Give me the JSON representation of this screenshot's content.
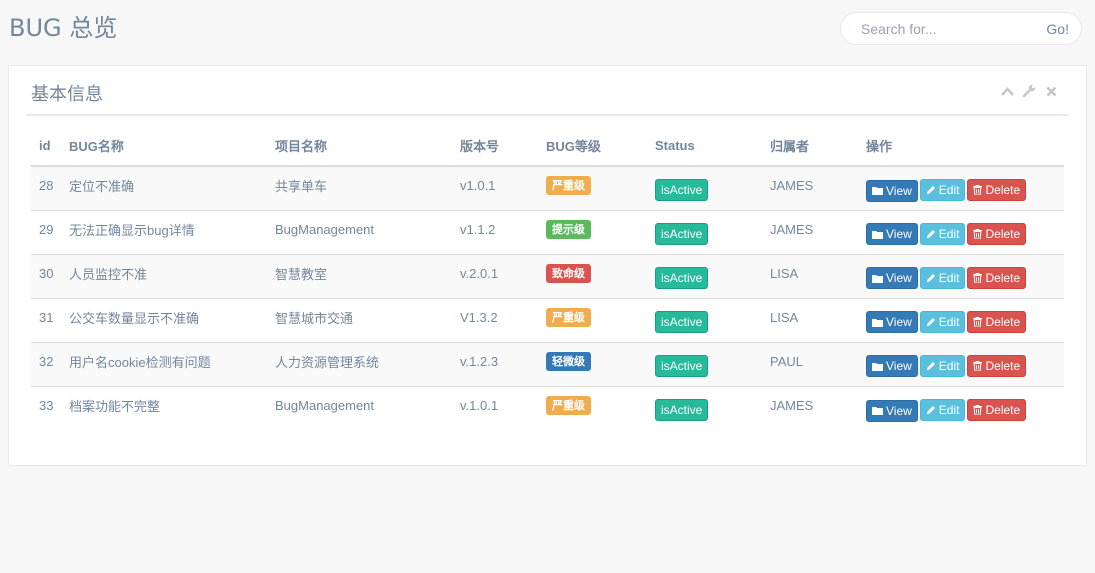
{
  "header": {
    "title": "BUG 总览",
    "search_placeholder": "Search for...",
    "search_button": "Go!"
  },
  "panel": {
    "title": "基本信息",
    "tools": [
      "chevron-up-icon",
      "wrench-icon",
      "close-icon"
    ]
  },
  "table": {
    "columns": {
      "id": "id",
      "name": "BUG名称",
      "project": "项目名称",
      "version": "版本号",
      "level": "BUG等级",
      "status": "Status",
      "owner": "归属者",
      "actions": "操作"
    },
    "rows": [
      {
        "id": "28",
        "name": "定位不准确",
        "project": "共享单车",
        "version": "v1.0.1",
        "level": "严重级",
        "level_color": "#f0ad4e",
        "status": "isActive",
        "owner": "JAMES"
      },
      {
        "id": "29",
        "name": "无法正确显示bug详情",
        "project": "BugManagement",
        "version": "v1.1.2",
        "level": "提示级",
        "level_color": "#5cb85c",
        "status": "isActive",
        "owner": "JAMES"
      },
      {
        "id": "30",
        "name": "人员监控不准",
        "project": "智慧教室",
        "version": "v.2.0.1",
        "level": "致命级",
        "level_color": "#d9534f",
        "status": "isActive",
        "owner": "LISA"
      },
      {
        "id": "31",
        "name": "公交车数量显示不准确",
        "project": "智慧城市交通",
        "version": "V1.3.2",
        "level": "严重级",
        "level_color": "#f0ad4e",
        "status": "isActive",
        "owner": "LISA"
      },
      {
        "id": "32",
        "name": "用户名cookie检测有问题",
        "project": "人力资源管理系统",
        "version": "v.1.2.3",
        "level": "轻微级",
        "level_color": "#337ab7",
        "status": "isActive",
        "owner": "PAUL"
      },
      {
        "id": "33",
        "name": "档案功能不完整",
        "project": "BugManagement",
        "version": "v.1.0.1",
        "level": "严重级",
        "level_color": "#f0ad4e",
        "status": "isActive",
        "owner": "JAMES"
      }
    ],
    "actions": {
      "view_label": "View",
      "edit_label": "Edit",
      "delete_label": "Delete"
    }
  },
  "colors": {
    "status": "#26b99a",
    "view": "#337ab7",
    "edit": "#5bc0de",
    "delete": "#d9534f"
  }
}
